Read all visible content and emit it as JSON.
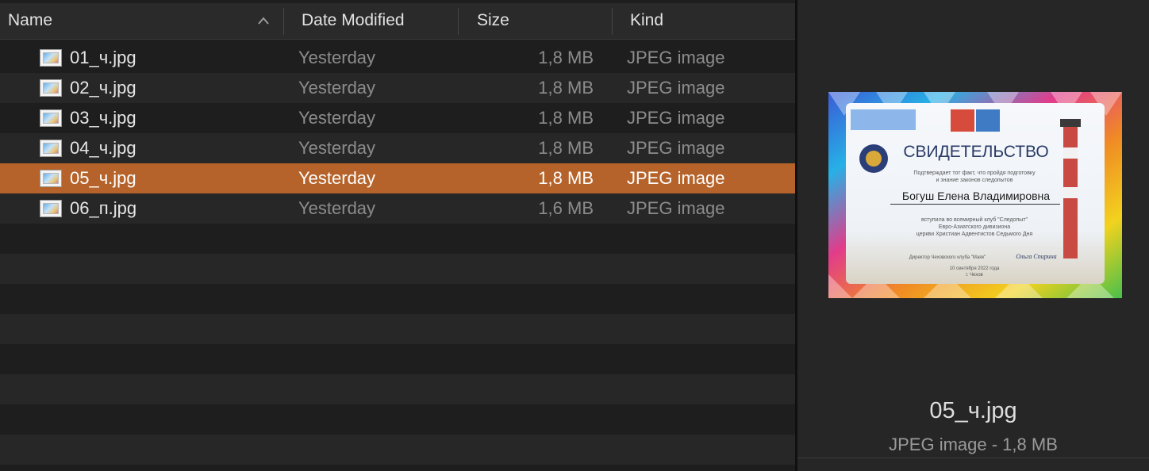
{
  "columns": {
    "name": "Name",
    "date_modified": "Date Modified",
    "size": "Size",
    "kind": "Kind"
  },
  "files": [
    {
      "name": "01_ч.jpg",
      "date": "Yesterday",
      "size": "1,8 MB",
      "kind": "JPEG image",
      "selected": false
    },
    {
      "name": "02_ч.jpg",
      "date": "Yesterday",
      "size": "1,8 MB",
      "kind": "JPEG image",
      "selected": false
    },
    {
      "name": "03_ч.jpg",
      "date": "Yesterday",
      "size": "1,8 MB",
      "kind": "JPEG image",
      "selected": false
    },
    {
      "name": "04_ч.jpg",
      "date": "Yesterday",
      "size": "1,8 MB",
      "kind": "JPEG image",
      "selected": false
    },
    {
      "name": "05_ч.jpg",
      "date": "Yesterday",
      "size": "1,8 MB",
      "kind": "JPEG image",
      "selected": true
    },
    {
      "name": "06_п.jpg",
      "date": "Yesterday",
      "size": "1,6 MB",
      "kind": "JPEG image",
      "selected": false
    }
  ],
  "preview": {
    "filename": "05_ч.jpg",
    "meta": "JPEG image - 1,8 MB",
    "certificate": {
      "title": "СВИДЕТЕЛЬСТВО",
      "line1": "Подтверждает тот факт, что пройдя подготовку",
      "line2": "и знание законов следопытов",
      "recipient": "Богуш Елена Владимировна",
      "line3": "вступила во всемирный клуб \"Следопыт\"",
      "line4": "Евро-Азиатского дивизиона",
      "line5": "церкви Христиан Адвентистов Седьмого Дня",
      "director": "Директор Чеховского клуба \"Маяк\"",
      "signature": "Ольга Спирина",
      "date_line": "10 сентября 2022 года",
      "city": "г. Чехов"
    }
  },
  "colors": {
    "selection": "#b5632a",
    "row_alt": "#272727",
    "background": "#1e1e1e"
  },
  "icons": {
    "sort": "chevron-up-icon",
    "file": "jpeg-file-icon"
  }
}
